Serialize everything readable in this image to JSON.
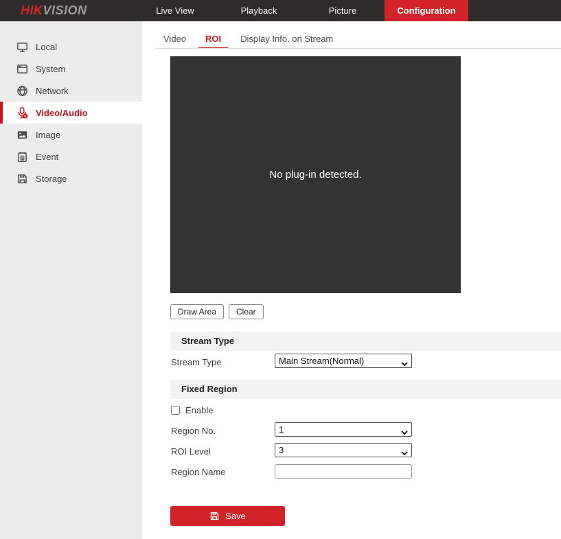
{
  "topbar": {
    "logo": {
      "hik": "HIK",
      "vision": "VISION"
    },
    "nav": [
      {
        "label": "Live View",
        "active": false
      },
      {
        "label": "Playback",
        "active": false
      },
      {
        "label": "Picture",
        "active": false
      },
      {
        "label": "Configuration",
        "active": true
      }
    ]
  },
  "sidebar": {
    "items": [
      {
        "label": "Local",
        "icon": "monitor-icon",
        "active": false
      },
      {
        "label": "System",
        "icon": "window-icon",
        "active": false
      },
      {
        "label": "Network",
        "icon": "globe-icon",
        "active": false
      },
      {
        "label": "Video/Audio",
        "icon": "microphone-icon",
        "active": true
      },
      {
        "label": "Image",
        "icon": "image-icon",
        "active": false
      },
      {
        "label": "Event",
        "icon": "event-icon",
        "active": false
      },
      {
        "label": "Storage",
        "icon": "storage-icon",
        "active": false
      }
    ]
  },
  "content": {
    "tabs": [
      {
        "label": "Video",
        "active": false
      },
      {
        "label": "ROI",
        "active": true
      },
      {
        "label": "Display Info. on Stream",
        "active": false
      }
    ],
    "preview": {
      "message": "No plug-in detected."
    },
    "buttons": {
      "draw_area": "Draw Area",
      "clear": "Clear"
    },
    "stream_type_section": {
      "title": "Stream Type",
      "label": "Stream Type",
      "value": "Main Stream(Normal)"
    },
    "fixed_region_section": {
      "title": "Fixed Region",
      "enable_label": "Enable",
      "enable_checked": false,
      "region_no_label": "Region No.",
      "region_no_value": "1",
      "roi_level_label": "ROI Level",
      "roi_level_value": "3",
      "region_name_label": "Region Name",
      "region_name_value": ""
    },
    "save_label": "Save"
  },
  "colors": {
    "accent_red": "#c9161d",
    "nav_active_red": "#d2232a",
    "topbar_bg": "#2d2c2b",
    "sidebar_bg": "#ececec",
    "preview_bg": "#333333",
    "section_bar_bg": "#f1f1f1"
  }
}
